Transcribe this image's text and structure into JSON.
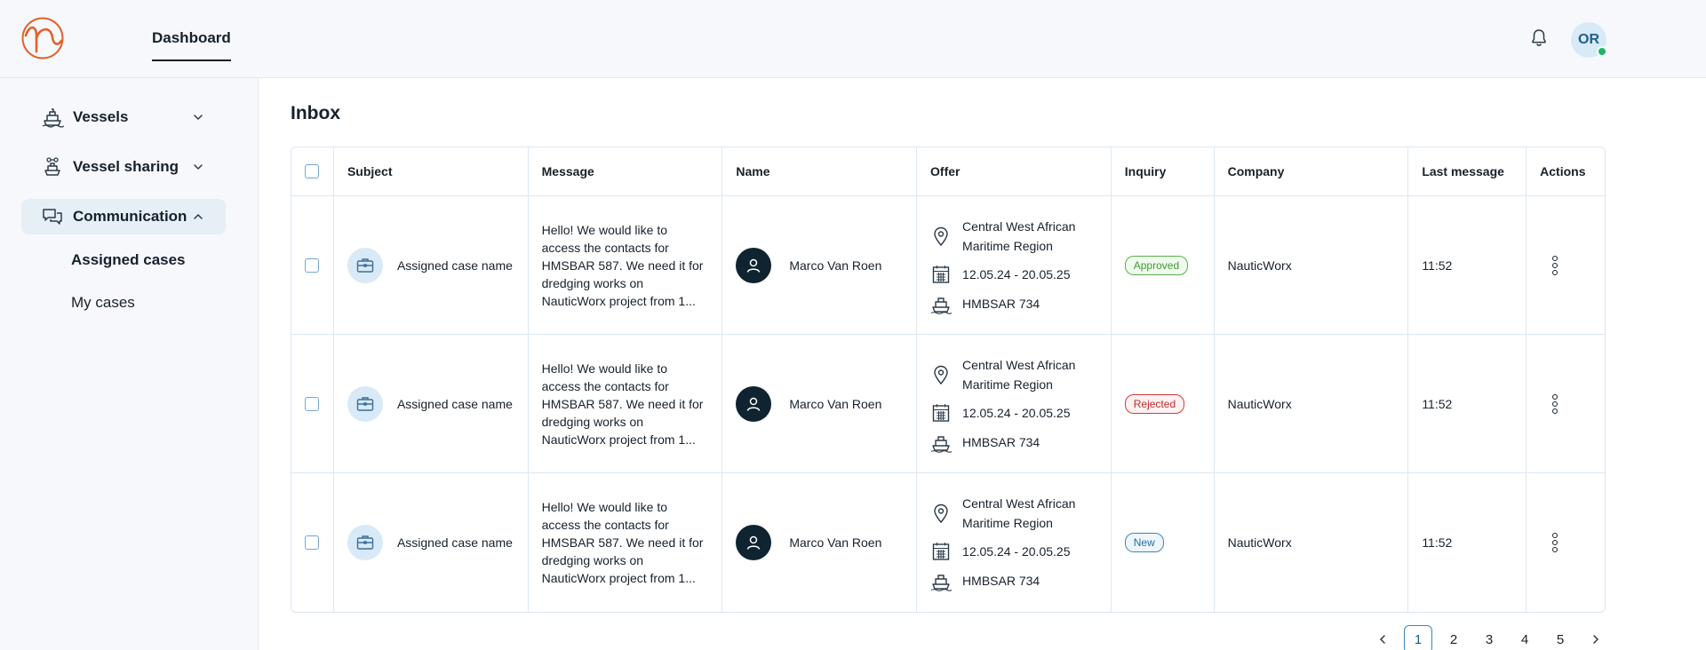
{
  "header": {
    "nav_tab": "Dashboard",
    "user_initials": "OR"
  },
  "sidebar": {
    "items": [
      {
        "label": "Vessels",
        "icon": "ship-icon"
      },
      {
        "label": "Vessel sharing",
        "icon": "ship-share-icon"
      },
      {
        "label": "Communication",
        "icon": "chat-icon"
      }
    ],
    "sub_items": [
      "Assigned cases",
      "My cases"
    ]
  },
  "main": {
    "title": "Inbox",
    "columns": [
      "Subject",
      "Message",
      "Name",
      "Offer",
      "Inquiry",
      "Company",
      "Last message",
      "Actions"
    ],
    "rows": [
      {
        "subject": "Assigned case name",
        "message": "Hello! We would like to access the contacts for HMSBAR 587. We need it for dredging works on NauticWorx project from 1...",
        "name": "Marco Van Roen",
        "offer_region": "Central West African Maritime Region",
        "offer_dates": "12.05.24 - 20.05.25",
        "offer_vessel": "HMBSAR 734",
        "inquiry": "Approved",
        "company": "NauticWorx",
        "last_message": "11:52"
      },
      {
        "subject": "Assigned case name",
        "message": "Hello! We would like to access the contacts for HMSBAR 587. We need it for dredging works on NauticWorx project from 1...",
        "name": "Marco Van Roen",
        "offer_region": "Central West African Maritime Region",
        "offer_dates": "12.05.24 - 20.05.25",
        "offer_vessel": "HMBSAR 734",
        "inquiry": "Rejected",
        "company": "NauticWorx",
        "last_message": "11:52"
      },
      {
        "subject": "Assigned case name",
        "message": "Hello! We would like to access the contacts for HMSBAR 587. We need it for dredging works on NauticWorx project from 1...",
        "name": "Marco Van Roen",
        "offer_region": "Central West African Maritime Region",
        "offer_dates": "12.05.24 - 20.05.25",
        "offer_vessel": "HMBSAR 734",
        "inquiry": "New",
        "company": "NauticWorx",
        "last_message": "11:52"
      }
    ]
  },
  "pagination": {
    "pages": [
      "1",
      "2",
      "3",
      "4",
      "5"
    ],
    "current": "1"
  },
  "colors": {
    "accent": "#3b86c2",
    "logo": "#e2622b",
    "approved": "#3f9b2f",
    "rejected": "#c52b2b",
    "new": "#1f6ea8",
    "online": "#21b36b"
  }
}
